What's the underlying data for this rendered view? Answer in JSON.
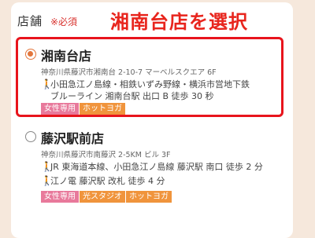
{
  "form": {
    "field_label": "店舗",
    "required_mark": "※必須"
  },
  "annotation": {
    "banner_text": "湘南台店を選択",
    "highlight_color": "#e8141c"
  },
  "stores": [
    {
      "name": "湘南台店",
      "selected": true,
      "address": "神奈川県藤沢市湘南台 2-10-7 マーベルスクエア 6F",
      "access_lines": [
        "小田急江ノ島線・相鉄いずみ野線・横浜市営地下鉄",
        "ブルーライン 湘南台駅 出口 B 徒歩 30 秒"
      ],
      "tags": [
        "女性専用",
        "ホットヨガ"
      ]
    },
    {
      "name": "藤沢駅前店",
      "selected": false,
      "address": "神奈川県藤沢市南藤沢 2-5KM ビル 3F",
      "access_lines": [
        "JR 東海道本線、小田急江ノ島線 藤沢駅 南口 徒歩 2 分",
        "江ノ電 藤沢駅 改札 徒歩 4 分"
      ],
      "tags": [
        "女性専用",
        "光スタジオ",
        "ホットヨガ"
      ]
    }
  ],
  "colors": {
    "accent": "#e3763c",
    "tag_pink": "#e8799b",
    "tag_orange": "#f0943c",
    "page_bg": "#f6e8dc"
  }
}
